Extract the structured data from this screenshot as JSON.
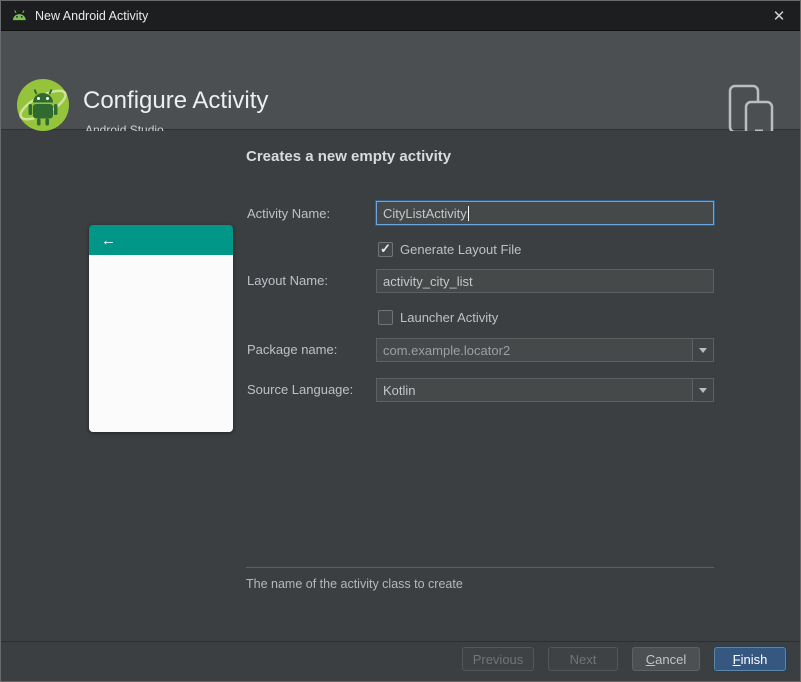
{
  "window": {
    "title": "New Android Activity"
  },
  "icons": {
    "close": "✕",
    "check": "✓",
    "back_arrow": "←"
  },
  "header": {
    "title": "Configure Activity",
    "subtitle": "Android Studio"
  },
  "content": {
    "heading": "Creates a new empty activity",
    "hint": "The name of the activity class to create",
    "form": {
      "activity_name": {
        "label": "Activity Name:",
        "value": "CityListActivity"
      },
      "generate_layout": {
        "label": "Generate Layout File",
        "checked": true
      },
      "layout_name": {
        "label": "Layout Name:",
        "value": "activity_city_list"
      },
      "launcher": {
        "label": "Launcher Activity",
        "checked": false
      },
      "package": {
        "label": "Package name:",
        "value": "com.example.locator2"
      },
      "language": {
        "label": "Source Language:",
        "value": "Kotlin"
      }
    }
  },
  "buttons": {
    "previous": "Previous",
    "next": "Next",
    "cancel": {
      "mnemonic": "C",
      "rest": "ancel"
    },
    "finish": {
      "mnemonic": "F",
      "rest": "inish"
    }
  },
  "colors": {
    "accent_teal": "#009688",
    "primary_button_blue": "#365880",
    "focus_border_blue": "#6aa6e0"
  }
}
